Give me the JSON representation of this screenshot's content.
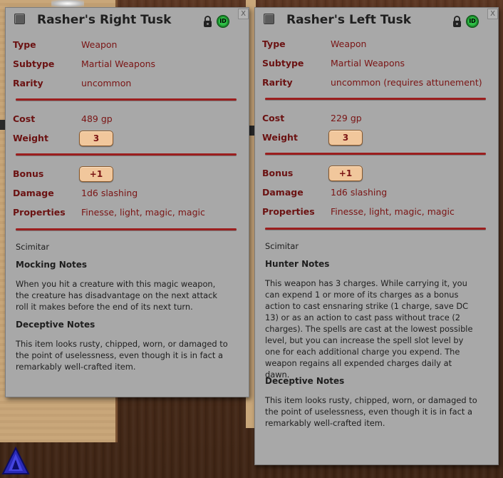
{
  "colors": {
    "window_bg": "#a8a8a8",
    "label": "#6b1212",
    "separator": "#9b1e1e",
    "pill": "#f1c79c",
    "id_green": "#2fbf46"
  },
  "windows": {
    "right": {
      "title": "Rasher's Right Tusk",
      "close": "X",
      "id_badge": "ID",
      "fields": {
        "type_label": "Type",
        "type_value": "Weapon",
        "subtype_label": "Subtype",
        "subtype_value": "Martial Weapons",
        "rarity_label": "Rarity",
        "rarity_value": "uncommon",
        "cost_label": "Cost",
        "cost_value": "489 gp",
        "weight_label": "Weight",
        "weight_value": "3",
        "bonus_label": "Bonus",
        "bonus_value": "+1",
        "damage_label": "Damage",
        "damage_value": "1d6 slashing",
        "properties_label": "Properties",
        "properties_value": "Finesse, light, magic, magic"
      },
      "base_item": "Scimitar",
      "notes": [
        {
          "heading": "Mocking Notes",
          "text": "When you hit a creature with this magic weapon, the creature has disadvantage on the next attack roll it makes before the end of its next turn."
        },
        {
          "heading": "Deceptive Notes",
          "text": "This item looks rusty, chipped, worn, or damaged to the point of uselessness, even though it is in fact a remarkably well-crafted item."
        }
      ]
    },
    "left": {
      "title": "Rasher's Left Tusk",
      "close": "X",
      "id_badge": "ID",
      "fields": {
        "type_label": "Type",
        "type_value": "Weapon",
        "subtype_label": "Subtype",
        "subtype_value": "Martial Weapons",
        "rarity_label": "Rarity",
        "rarity_value": "uncommon (requires attunement)",
        "cost_label": "Cost",
        "cost_value": "229 gp",
        "weight_label": "Weight",
        "weight_value": "3",
        "bonus_label": "Bonus",
        "bonus_value": "+1",
        "damage_label": "Damage",
        "damage_value": "1d6 slashing",
        "properties_label": "Properties",
        "properties_value": "Finesse, light, magic, magic"
      },
      "base_item": "Scimitar",
      "notes": [
        {
          "heading": "Hunter Notes",
          "text": "This weapon has 3 charges. While carrying it, you can expend 1 or more of its charges as a bonus action to cast ensnaring strike (1 charge, save DC 13) or as an action to cast pass without trace (2 charges). The spells are cast at the lowest possible level, but you can increase the spell slot level by one for each additional charge you expend. The weapon regains all expended charges daily at dawn."
        },
        {
          "heading": "Deceptive Notes",
          "text": "This item looks rusty, chipped, worn, or damaged to the point of uselessness, even though it is in fact a remarkably well-crafted item."
        }
      ]
    }
  }
}
